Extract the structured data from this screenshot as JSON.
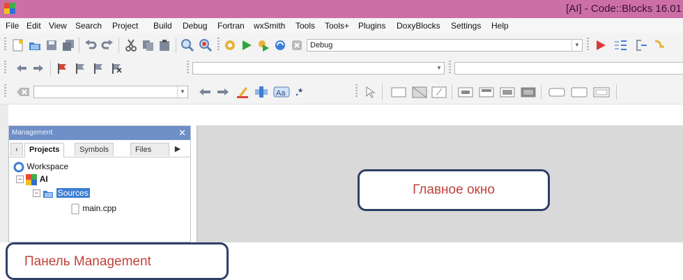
{
  "window": {
    "title": "[AI] - Code::Blocks 16.01"
  },
  "menu": [
    "File",
    "Edit",
    "View",
    "Search",
    "Project",
    "Build",
    "Debug",
    "Fortran",
    "wxSmith",
    "Tools",
    "Tools+",
    "Plugins",
    "DoxyBlocks",
    "Settings",
    "Help"
  ],
  "toolbar1": {
    "build_target": "Debug",
    "icons": [
      "new-file-icon",
      "open-file-icon",
      "save-icon",
      "save-all-icon",
      "undo-icon",
      "redo-icon",
      "cut-icon",
      "copy-icon",
      "paste-icon",
      "find-icon",
      "replace-icon",
      "build-icon",
      "run-icon",
      "build-and-run-icon",
      "rebuild-icon",
      "abort-icon",
      "debug-run-icon",
      "step-into-icon",
      "step-out-icon"
    ]
  },
  "toolbar2": {
    "code_completion_value": ""
  },
  "toolbar3": {
    "search_value": "",
    "regex_label": ".*"
  },
  "management": {
    "title": "Management",
    "tabs": [
      "Projects",
      "Symbols",
      "Files"
    ],
    "active_tab": "Projects",
    "tree": {
      "workspace": "Workspace",
      "project": "AI",
      "folder": "Sources",
      "file": "main.cpp"
    }
  },
  "annotations": {
    "main_window": "Главное окно",
    "management_panel": "Панель Management"
  },
  "colors": {
    "titlebar": "#cc6fa6",
    "panel_header": "#6e8fc7",
    "callout_border": "#2e3f66",
    "callout_text": "#c0413a",
    "selection": "#3d7fd6"
  }
}
